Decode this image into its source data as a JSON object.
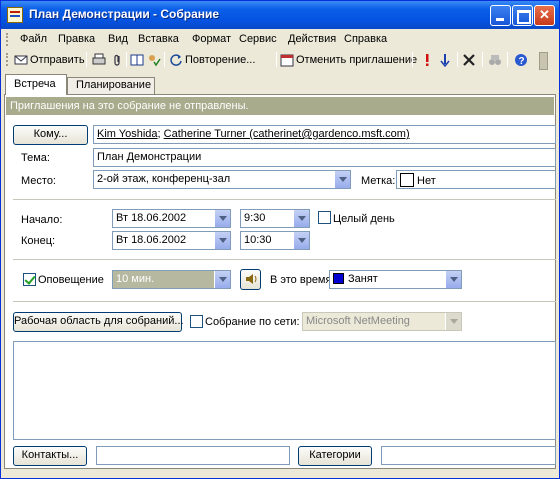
{
  "window": {
    "title": "План Демонстрации - Собрание"
  },
  "menu": [
    "Файл",
    "Правка",
    "Вид",
    "Вставка",
    "Формат",
    "Сервис",
    "Действия",
    "Справка"
  ],
  "toolbar": {
    "send_label": "Отправить",
    "recurrence_label": "Повторение...",
    "cancel_invite_label": "Отменить приглашение"
  },
  "tabs": [
    "Встреча",
    "Планирование"
  ],
  "info_bar": "Приглашения на это собрание не отправлены.",
  "form": {
    "to_button": "Кому...",
    "attendees": [
      "Kim Yoshida",
      "Catherine Turner (catherinet@gardenco.msft.com)"
    ],
    "subject_label": "Тема:",
    "subject_value": "План Демонстрации",
    "location_label": "Место:",
    "location_value": "2-ой этаж, конференц-зал",
    "label_label": "Метка:",
    "label_value": "Нет",
    "start_label": "Начало:",
    "start_date": "Вт 18.06.2002",
    "start_time": "9:30",
    "all_day_label": "Целый день",
    "end_label": "Конец:",
    "end_date": "Вт 18.06.2002",
    "end_time": "10:30",
    "reminder_label": "Оповещение",
    "reminder_value": "10 мин.",
    "show_as_label": "В это время:",
    "show_as_value": "Занят",
    "workspace_button": "Рабочая область для собраний...",
    "online_label": "Собрание по сети:",
    "online_value": "Microsoft NetMeeting",
    "contacts_button": "Контакты...",
    "categories_button": "Категории"
  },
  "colors": {
    "title_bar": "#0553e0",
    "busy": "#0000d0",
    "info_bar": "#a8ab8c"
  }
}
